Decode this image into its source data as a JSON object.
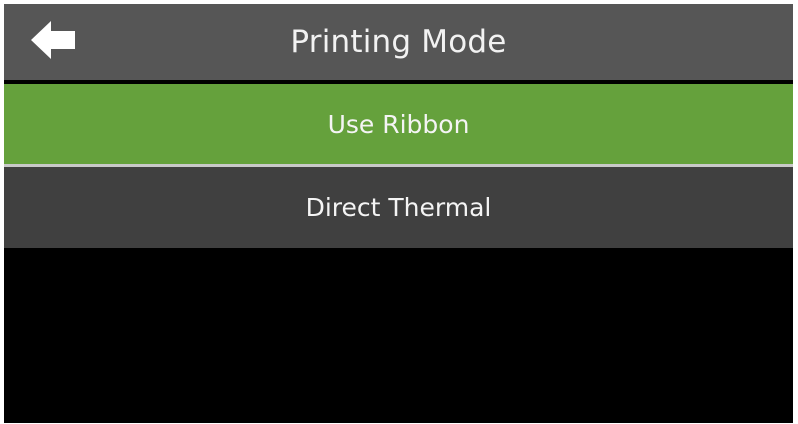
{
  "header": {
    "title": "Printing Mode",
    "back_icon": "arrow-left-icon",
    "background": "#565656"
  },
  "options": [
    {
      "label": "Use Ribbon",
      "selected": true,
      "color": "#65a13c"
    },
    {
      "label": "Direct Thermal",
      "selected": false,
      "color": "#404040"
    }
  ],
  "colors": {
    "screen": "#000000",
    "text": "#f4f4f4",
    "divider": "#c9c9c9"
  }
}
